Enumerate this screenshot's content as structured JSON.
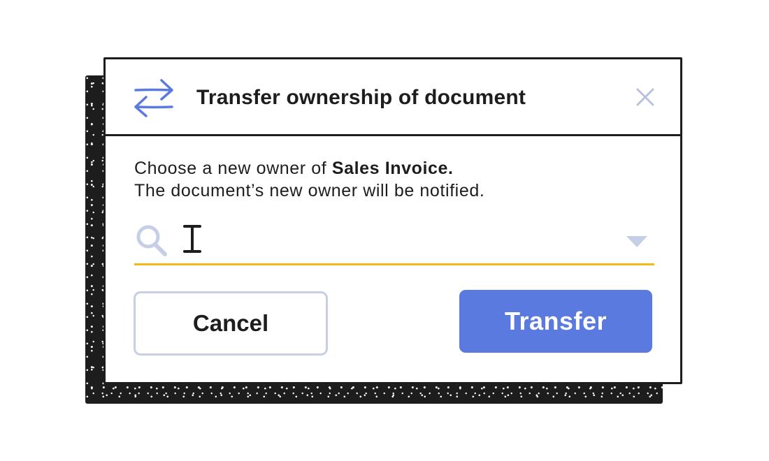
{
  "dialog": {
    "title": "Transfer ownership of document",
    "header_icon": "transfer-arrows-icon",
    "close_icon": "close-icon",
    "description_prefix": "Choose a new owner of ",
    "document_name": "Sales Invoice.",
    "description_line2": "The document’s new owner will be notified."
  },
  "search": {
    "icon": "search-icon",
    "value": "",
    "placeholder": "",
    "dropdown_icon": "chevron-down-icon"
  },
  "buttons": {
    "cancel_label": "Cancel",
    "transfer_label": "Transfer"
  },
  "colors": {
    "accent": "#5b7ae0",
    "input_underline": "#f5b91b",
    "muted_icon": "#c6cfe6",
    "ink": "#1d1d1d"
  }
}
